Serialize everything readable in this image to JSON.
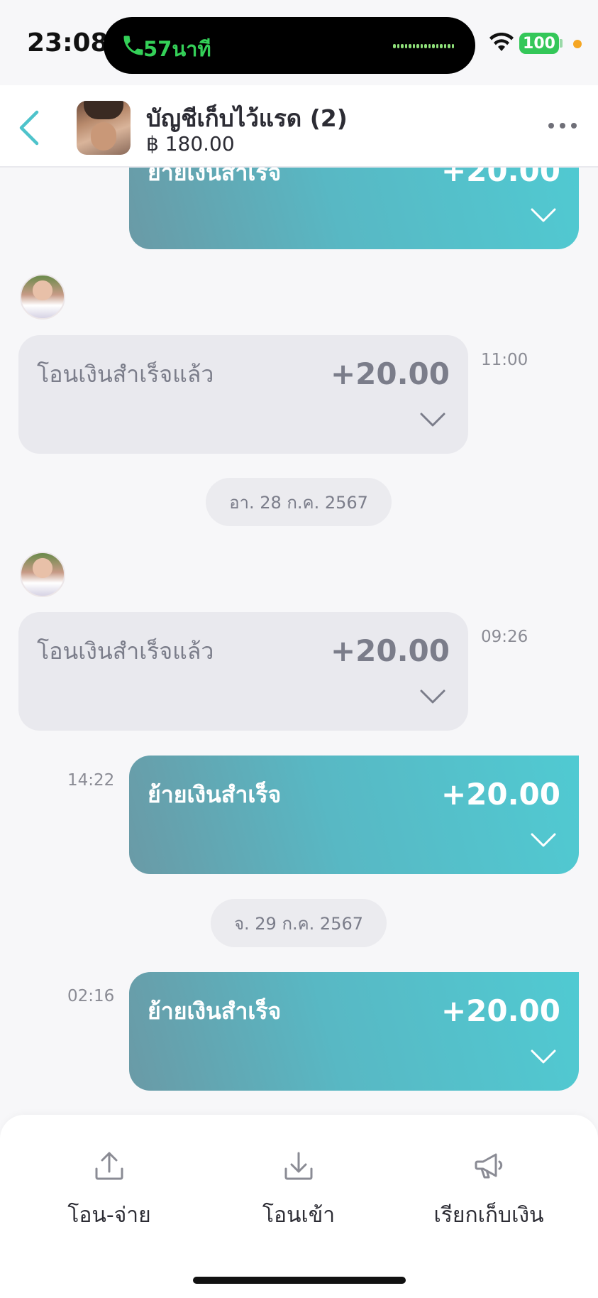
{
  "status_bar": {
    "time": "23:08",
    "call_text": "57นาที",
    "battery": "100"
  },
  "header": {
    "title": "บัญชีเก็บไว้แรด (2)",
    "balance": "฿ 180.00"
  },
  "messages": [
    {
      "type": "outgoing",
      "label": "ย้ายเงินสำเร็จ",
      "amount": "+20.00",
      "time": ""
    },
    {
      "type": "incoming",
      "label": "โอนเงินสำเร็จแล้ว",
      "amount": "+20.00",
      "time": "11:00"
    },
    {
      "type": "date",
      "text": "อา. 28 ก.ค. 2567"
    },
    {
      "type": "incoming",
      "label": "โอนเงินสำเร็จแล้ว",
      "amount": "+20.00",
      "time": "09:26"
    },
    {
      "type": "outgoing",
      "label": "ย้ายเงินสำเร็จ",
      "amount": "+20.00",
      "time": "14:22"
    },
    {
      "type": "date",
      "text": "จ. 29 ก.ค. 2567"
    },
    {
      "type": "outgoing",
      "label": "ย้ายเงินสำเร็จ",
      "amount": "+20.00",
      "time": "02:16"
    }
  ],
  "bottom_actions": [
    {
      "label": "โอน-จ่าย",
      "icon": "upload-icon"
    },
    {
      "label": "โอนเข้า",
      "icon": "download-icon"
    },
    {
      "label": "เรียกเก็บเงิน",
      "icon": "megaphone-icon"
    }
  ],
  "colors": {
    "accent": "#50cad2",
    "gradient_start": "#6a9aa6",
    "incoming_bubble": "#e9e9ee",
    "call_green": "#34d058",
    "battery_green": "#34c759"
  }
}
